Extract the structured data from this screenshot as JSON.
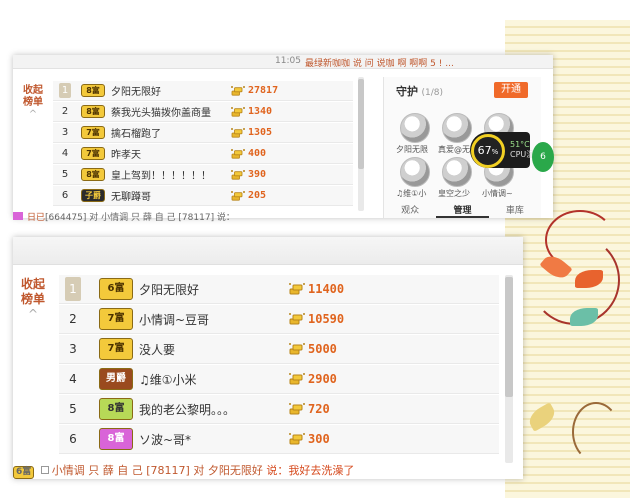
{
  "top": {
    "strip_time": "11:05",
    "strip_text": "最绿新咖咖 说 问 说咖 啊 啊啊 5 ! ...",
    "side_label_1": "收起",
    "side_label_2": "榜单",
    "rows": [
      {
        "rank": "1",
        "badge": "8富",
        "name": "夕阳无限好",
        "amount": "27817"
      },
      {
        "rank": "2",
        "badge": "8富",
        "name": "蔡我光头猫拨你盖商量",
        "amount": "1340"
      },
      {
        "rank": "3",
        "badge": "7富",
        "name": "擒石榴跑了",
        "amount": "1305"
      },
      {
        "rank": "4",
        "badge": "7富",
        "name": "昨孝天",
        "amount": "400"
      },
      {
        "rank": "5",
        "badge": "8富",
        "name": "皇上驾到！！！！！！",
        "amount": "390"
      },
      {
        "rank": "6",
        "badge": "子爵",
        "name": "无聊蹲哥",
        "amount": "205"
      }
    ],
    "bottom_text": "[664475] 对 小情调 只 薛 自 己 [78117] 说：",
    "guard": {
      "title": "守护",
      "count": "(1/8)",
      "open_button": "开通",
      "names": [
        "夕阳无限",
        "真爱@无",
        "♫维①小",
        "皇空之少",
        "小情调~"
      ],
      "tabs": [
        "观众",
        "管理",
        "車库"
      ]
    },
    "cpu": {
      "percent": "67",
      "unit": "%",
      "temp": "51°C",
      "label": "CPU温",
      "green": "6"
    }
  },
  "bottom": {
    "side_label_1": "收起",
    "side_label_2": "榜单",
    "rows": [
      {
        "rank": "1",
        "badge": "6富",
        "name": "夕阳无限好",
        "amount": "11400"
      },
      {
        "rank": "2",
        "badge": "7富",
        "name": "小情调~豆哥",
        "amount": "10590"
      },
      {
        "rank": "3",
        "badge": "7富",
        "name": "没人要",
        "amount": "5000"
      },
      {
        "rank": "4",
        "badge": "男爵",
        "name": "♫维①小米",
        "amount": "2900"
      },
      {
        "rank": "5",
        "badge": "8富",
        "name": "我的老公黎明。。。",
        "amount": "720"
      },
      {
        "rank": "6",
        "badge": "8富",
        "name": "ソ波~哥*",
        "amount": "300"
      }
    ],
    "bottom_badge": "6富",
    "bottom_text": "小情调 只 薛 自 己 [78117] 对",
    "bottom_name": "夕阳无限好",
    "bottom_say": "说：我好去洗澡了"
  },
  "colors": {
    "badge_gold": "#f3c93b",
    "badge_green": "#b7d957",
    "badge_purple": "#d964d8",
    "badge_brown": "#9a4a1e",
    "amount": "#e0641e",
    "accent_orange": "#f06a2a"
  }
}
